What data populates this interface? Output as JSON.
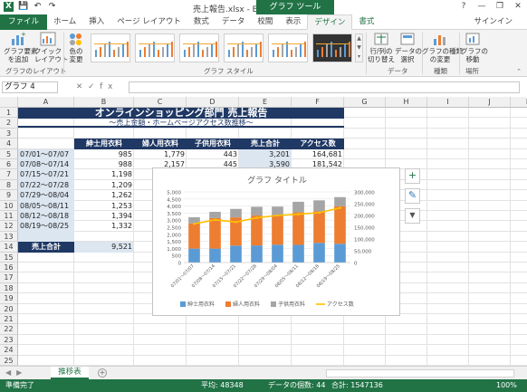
{
  "window": {
    "title": "売上報告.xlsx - Excel",
    "context_tab": "グラフ ツール",
    "controls": [
      "?",
      "—",
      "❐",
      "✕"
    ]
  },
  "quick_access": {
    "save": "💾",
    "undo": "↶",
    "redo": "↷"
  },
  "tabs": [
    {
      "label": "ファイル",
      "kind": "file"
    },
    {
      "label": "ホーム",
      "kind": "normal"
    },
    {
      "label": "挿入",
      "kind": "normal"
    },
    {
      "label": "ページ レイアウト",
      "kind": "normal"
    },
    {
      "label": "数式",
      "kind": "normal"
    },
    {
      "label": "データ",
      "kind": "normal"
    },
    {
      "label": "校閲",
      "kind": "normal"
    },
    {
      "label": "表示",
      "kind": "normal"
    },
    {
      "label": "デザイン",
      "kind": "active"
    },
    {
      "label": "書式",
      "kind": "ctx"
    }
  ],
  "signin": "サインイン",
  "ribbon": {
    "add_element": "グラフ要素\nを追加",
    "quick_layout": "クイック\nレイアウト",
    "change_color": "色の\n変更",
    "layout_group": "グラフのレイアウト",
    "style_group": "グラフ スタイル",
    "switch_rowcol": "行/列の\n切り替え",
    "select_data": "データの\n選択",
    "data_group": "データ",
    "change_type": "グラフの種類\nの変更",
    "type_group": "種類",
    "move_chart": "グラフの\n移動",
    "location_group": "場所"
  },
  "formula_bar": {
    "name_box": "グラフ 4",
    "icons": "✕✓fx",
    "value": ""
  },
  "columns": [
    "A",
    "B",
    "C",
    "D",
    "E",
    "F",
    "G",
    "H",
    "I",
    "J",
    "K"
  ],
  "rows": [
    "1",
    "2",
    "3",
    "4",
    "5",
    "6",
    "7",
    "8",
    "9",
    "10",
    "11",
    "12",
    "13",
    "14",
    "15",
    "16",
    "17",
    "18",
    "19",
    "20",
    "21",
    "22",
    "23",
    "24",
    "25"
  ],
  "sheet": {
    "banner": "オンラインショッピング部門 売上報告",
    "subbanner": "～売上金額・ホームページアクセス数推移～",
    "headers": [
      "紳士用衣料",
      "婦人用衣料",
      "子供用衣料",
      "売上合計",
      "アクセス数"
    ],
    "row_labels": [
      "07/01～07/07",
      "07/08～07/14",
      "07/15～07/21",
      "07/22～07/28",
      "07/29～08/04",
      "08/05～08/11",
      "08/12～08/18",
      "08/19～08/25"
    ],
    "col_b": [
      "985",
      "988",
      "1,198",
      "1,209",
      "1,262",
      "1,253",
      "1,394",
      "1,332"
    ],
    "col_c": [
      "1,779",
      "2,157"
    ],
    "col_d": [
      "443",
      "445"
    ],
    "col_e": [
      "3,201",
      "3,590"
    ],
    "col_f": [
      "164,681",
      "181,542"
    ],
    "total_label": "売上合計",
    "total_b": "9,521"
  },
  "chart_data": {
    "type": "bar",
    "title": "グラフ タイトル",
    "categories": [
      "07/01～07/07",
      "07/08～07/14",
      "07/15～07/21",
      "07/22～07/28",
      "07/29～08/04",
      "08/05～08/11",
      "08/12～08/18",
      "08/19～08/25"
    ],
    "series": [
      {
        "name": "紳士用衣料",
        "type": "stacked-bar",
        "axis": "left",
        "color": "#5b9bd5",
        "values": [
          985,
          988,
          1198,
          1209,
          1262,
          1253,
          1394,
          1332
        ]
      },
      {
        "name": "婦人用衣料",
        "type": "stacked-bar",
        "axis": "left",
        "color": "#ed7d31",
        "values": [
          1779,
          2157,
          2000,
          2120,
          2100,
          2300,
          2230,
          2650
        ]
      },
      {
        "name": "子供用衣料",
        "type": "stacked-bar",
        "axis": "left",
        "color": "#a5a5a5",
        "values": [
          443,
          445,
          600,
          620,
          600,
          750,
          780,
          650
        ]
      },
      {
        "name": "アクセス数",
        "type": "line",
        "axis": "right",
        "color": "#ffc000",
        "values": [
          164681,
          181542,
          172000,
          190000,
          200000,
          205000,
          212000,
          232000
        ]
      }
    ],
    "ylim": [
      0,
      5000
    ],
    "yticks": [
      "0",
      "500",
      "1,000",
      "1,500",
      "2,000",
      "2,500",
      "3,000",
      "3,500",
      "4,000",
      "4,500",
      "5,000"
    ],
    "y2lim": [
      0,
      300000
    ],
    "y2ticks": [
      "0",
      "50,000",
      "100,000",
      "150,000",
      "200,000",
      "250,000",
      "300,000"
    ],
    "legend": "bottom"
  },
  "chart_tools": {
    "plus": "+",
    "brush": "✎",
    "filter": "▼"
  },
  "sheet_tab": "推移表",
  "add_sheet": "+",
  "sheet_nav": "◀▶",
  "status": {
    "ready": "準備完了",
    "average": "平均: 48348",
    "count": "データの個数: 44",
    "sum": "合計: 1547136",
    "zoom": "100%"
  },
  "colors": {
    "accent": "#217346",
    "header": "#1f3864",
    "date_fill": "#dce6f1"
  }
}
